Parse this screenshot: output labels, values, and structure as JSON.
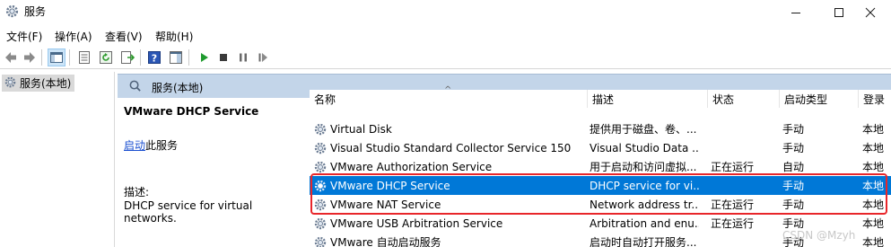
{
  "window": {
    "title": "服务"
  },
  "menu": {
    "items": [
      "文件(F)",
      "操作(A)",
      "查看(V)",
      "帮助(H)"
    ]
  },
  "tree": {
    "root_label": "服务(本地)"
  },
  "panel": {
    "header": "服务(本地)"
  },
  "details": {
    "service_title": "VMware DHCP Service",
    "start_link": "启动",
    "start_suffix": "此服务",
    "description_label": "描述:",
    "description_text": "DHCP service for virtual networks."
  },
  "table": {
    "columns": {
      "name": "名称",
      "desc": "描述",
      "status": "状态",
      "startup": "启动类型",
      "logon": "登录"
    },
    "rows": [
      {
        "name": "Virtual Disk",
        "desc": "提供用于磁盘、卷、...",
        "status": "",
        "startup": "手动",
        "logon": "本地"
      },
      {
        "name": "Visual Studio Standard Collector Service 150",
        "desc": "Visual Studio Data ...",
        "status": "",
        "startup": "手动",
        "logon": "本地"
      },
      {
        "name": "VMware Authorization Service",
        "desc": "用于启动和访问虚拟...",
        "status": "正在运行",
        "startup": "自动",
        "logon": "本地"
      },
      {
        "name": "VMware DHCP Service",
        "desc": "DHCP service for vi...",
        "status": "",
        "startup": "手动",
        "logon": "本地"
      },
      {
        "name": "VMware NAT Service",
        "desc": "Network address tr...",
        "status": "正在运行",
        "startup": "手动",
        "logon": "本地"
      },
      {
        "name": "VMware USB Arbitration Service",
        "desc": "Arbitration and enu...",
        "status": "正在运行",
        "startup": "手动",
        "logon": "本地"
      },
      {
        "name": "VMware 自动启动服务",
        "desc": "启动时自动打开服务...",
        "status": "",
        "startup": "手动",
        "logon": "本地"
      }
    ]
  },
  "watermark": "CSDN @Mzyh",
  "colors": {
    "selection": "#0078d7",
    "highlight_border": "#e8262a",
    "panel_header": "#c3d5e9"
  }
}
